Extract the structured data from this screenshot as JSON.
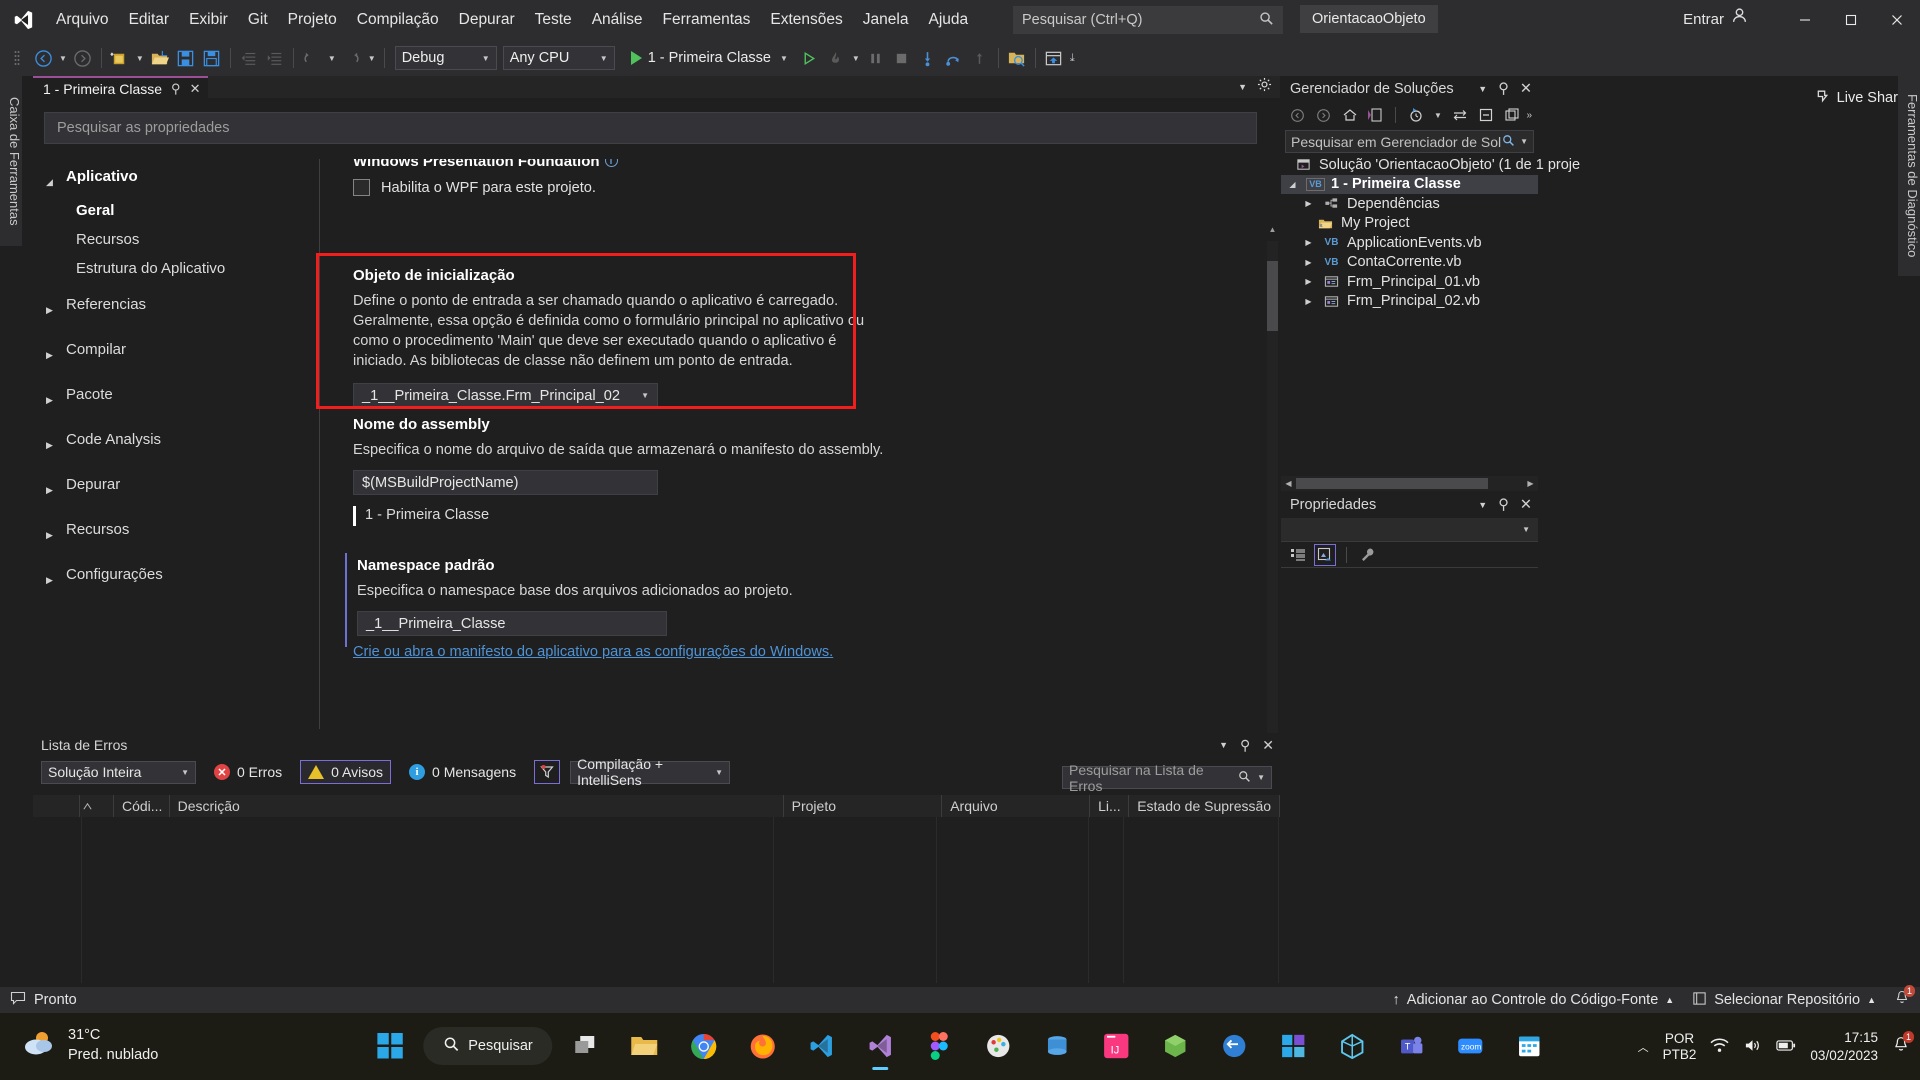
{
  "window": {
    "menu": [
      "Arquivo",
      "Editar",
      "Exibir",
      "Git",
      "Projeto",
      "Compilação",
      "Depurar",
      "Teste",
      "Análise",
      "Ferramentas",
      "Extensões",
      "Janela",
      "Ajuda"
    ],
    "search_placeholder": "Pesquisar (Ctrl+Q)",
    "project_chip": "OrientacaoObjeto",
    "sign_in": "Entrar"
  },
  "toolbar": {
    "config": "Debug",
    "platform": "Any CPU",
    "run_target": "1 - Primeira Classe",
    "live_share": "Live Share"
  },
  "doc_tab": {
    "title": "1 - Primeira Classe"
  },
  "properties_page": {
    "search_placeholder": "Pesquisar as propriedades",
    "nav": [
      {
        "label": "Aplicativo",
        "expanded": true,
        "bold": true,
        "arrow": "expanded"
      },
      {
        "label": "Geral",
        "sub": true,
        "selected": true
      },
      {
        "label": "Recursos",
        "sub": true,
        "selected": false
      },
      {
        "label": "Estrutura do Aplicativo",
        "sub": true,
        "selected": false
      },
      {
        "label": "Referencias",
        "arrow": "collapsed"
      },
      {
        "label": "Compilar",
        "arrow": "collapsed"
      },
      {
        "label": "Pacote",
        "arrow": "collapsed"
      },
      {
        "label": "Code Analysis",
        "arrow": "collapsed"
      },
      {
        "label": "Depurar",
        "arrow": "collapsed"
      },
      {
        "label": "Recursos",
        "arrow": "collapsed"
      },
      {
        "label": "Configurações",
        "arrow": "collapsed"
      }
    ],
    "wpf": {
      "title": "Windows Presentation Foundation",
      "checkbox_label": "Habilita o WPF para este projeto.",
      "checked": false
    },
    "startup_object": {
      "title": "Objeto de inicialização",
      "description": "Define o ponto de entrada a ser chamado quando o aplicativo é carregado. Geralmente, essa opção é definida como o formulário principal no aplicativo ou como o procedimento 'Main' que deve ser executado quando o aplicativo é iniciado. As bibliotecas de classe não definem um ponto de entrada.",
      "value": "_1__Primeira_Classe.Frm_Principal_02",
      "highlight_color": "#f21d1d"
    },
    "assembly_name": {
      "title": "Nome do assembly",
      "description": "Especifica o nome do arquivo de saída que armazenará o manifesto do assembly.",
      "value": "$(MSBuildProjectName)",
      "hint": "1 - Primeira Classe"
    },
    "default_namespace": {
      "title": "Namespace padrão",
      "description": "Especifica o namespace base dos arquivos adicionados ao projeto.",
      "value": "_1__Primeira_Classe",
      "accent_color": "#6f6fd8"
    },
    "manifest_link": "Crie ou abra o manifesto do aplicativo para as configurações do Windows."
  },
  "error_list": {
    "title": "Lista de Erros",
    "scope": "Solução Inteira",
    "errors": "0 Erros",
    "warnings": "0 Avisos",
    "messages": "0 Mensagens",
    "build_filter": "Compilação + IntelliSens",
    "search_placeholder": "Pesquisar na Lista de Erros",
    "columns": [
      "",
      "Códi...",
      "Descrição",
      "Projeto",
      "Arquivo",
      "Li...",
      "Estado de Supressão"
    ],
    "rows": []
  },
  "solution_explorer": {
    "title": "Gerenciador de Soluções",
    "search_placeholder": "Pesquisar em Gerenciador de Soluções (",
    "tree": [
      {
        "label": "Solução 'OrientacaoObjeto' (1 de 1 proje",
        "icon": "solution-icon",
        "indent": 0,
        "twisty": "",
        "bold": false,
        "selected": false
      },
      {
        "label": "1 - Primeira Classe",
        "icon": "vb-project-icon",
        "indent": 1,
        "twisty": "expanded",
        "bold": true,
        "selected": true
      },
      {
        "label": "Dependências",
        "icon": "dependencies-icon",
        "indent": 2,
        "twisty": "collapsed",
        "bold": false,
        "selected": false
      },
      {
        "label": "My Project",
        "icon": "my-project-folder-icon",
        "indent": 2,
        "twisty": "",
        "bold": false,
        "selected": false
      },
      {
        "label": "ApplicationEvents.vb",
        "icon": "vb-file-icon",
        "indent": 2,
        "twisty": "collapsed",
        "bold": false,
        "selected": false
      },
      {
        "label": "ContaCorrente.vb",
        "icon": "vb-file-icon",
        "indent": 2,
        "twisty": "collapsed",
        "bold": false,
        "selected": false
      },
      {
        "label": "Frm_Principal_01.vb",
        "icon": "form-icon",
        "indent": 2,
        "twisty": "collapsed",
        "bold": false,
        "selected": false
      },
      {
        "label": "Frm_Principal_02.vb",
        "icon": "form-icon",
        "indent": 2,
        "twisty": "collapsed",
        "bold": false,
        "selected": false
      }
    ]
  },
  "properties_panel": {
    "title": "Propriedades",
    "selected_object": ""
  },
  "vertical_tabs": {
    "left": "Caixa de Ferramentas",
    "right": "Ferramentas de Diagnóstico"
  },
  "status_bar": {
    "state": "Pronto",
    "source_control": "Adicionar ao Controle do Código-Fonte",
    "repository": "Selecionar Repositório",
    "notification_count": "1"
  },
  "taskbar": {
    "temperature": "31°C",
    "weather": "Pred. nublado",
    "search": "Pesquisar",
    "language_line1": "POR",
    "language_line2": "PTB2",
    "time": "17:15",
    "date": "03/02/2023",
    "notification_count": "1"
  }
}
